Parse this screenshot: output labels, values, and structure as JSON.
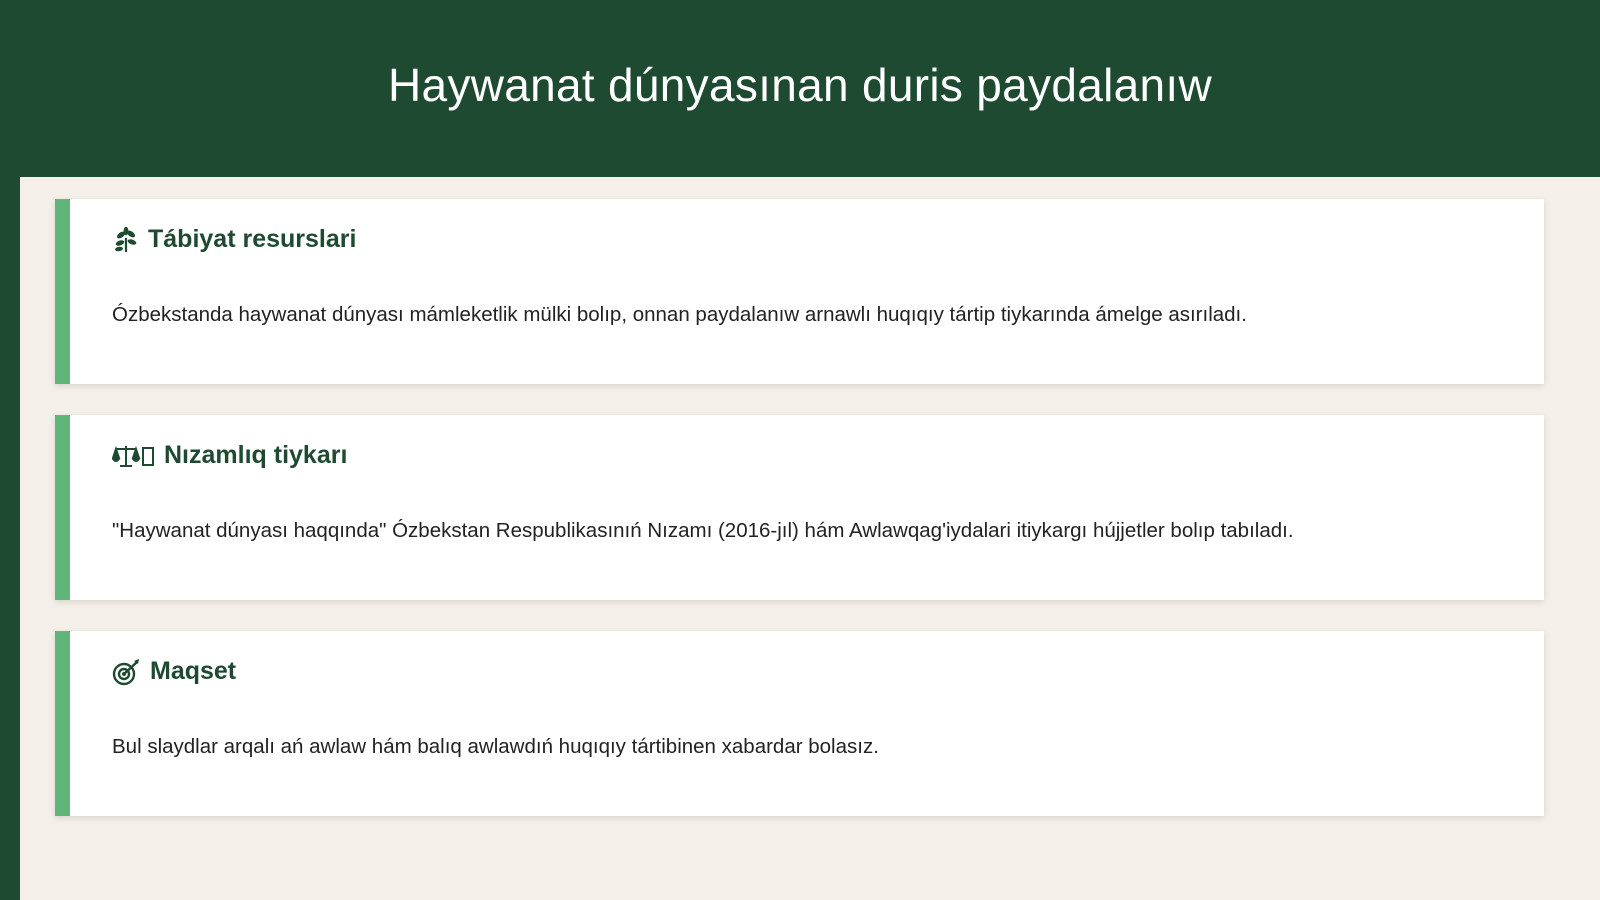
{
  "slide": {
    "title": "Haywanat dúnyasınan duris paydalanıw",
    "colors": {
      "header_bg": "#1d4a30",
      "content_bg": "#f4f0e9",
      "accent": "#5fb57a",
      "heading_text": "#1d4a30"
    },
    "cards": [
      {
        "icon": "herb-icon",
        "heading": "Tábiyat resurslari",
        "text": "Ózbekstanda haywanat dúnyası mámleketlik mülki bolıp, onnan paydalanıw arnawlı huqıqıy tártip tiykarında ámelge asırıladı."
      },
      {
        "icon": "scales-icon",
        "heading": "Nızamlıq tiykarı",
        "text": "\"Haywanat dúnyası haqqında\" Ózbekstan Respublikasınıń Nızamı (2016-jıl) hám Awlawqag'iydalari itiykargı hújjetler bolıp tabıladı."
      },
      {
        "icon": "target-icon",
        "heading": "Maqset",
        "text": "Bul slaydlar arqalı ań awlaw hám balıq awlawdıń huqıqıy tártibinen xabardar bolasız."
      }
    ]
  }
}
